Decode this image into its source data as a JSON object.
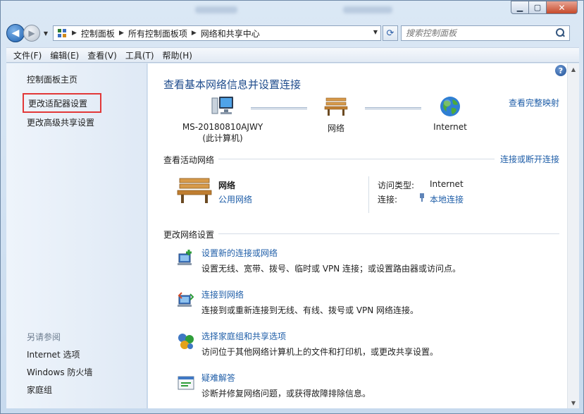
{
  "nav": {
    "breadcrumb": [
      "控制面板",
      "所有控制面板项",
      "网络和共享中心"
    ],
    "search_placeholder": "搜索控制面板"
  },
  "menu": [
    "文件(F)",
    "编辑(E)",
    "查看(V)",
    "工具(T)",
    "帮助(H)"
  ],
  "left_pane": {
    "links": [
      "控制面板主页",
      "更改适配器设置",
      "更改高级共享设置"
    ],
    "selected_link": "更改适配器设置",
    "see_also_header": "另请参阅",
    "see_also": [
      "Internet 选项",
      "Windows 防火墙",
      "家庭组"
    ]
  },
  "main": {
    "title": "查看基本网络信息并设置连接",
    "full_map_link": "查看完整映射",
    "nodes": [
      {
        "label": "MS-20180810AJWY",
        "sub": "(此计算机)",
        "icon": "computer-icon"
      },
      {
        "label": "网络",
        "sub": "",
        "icon": "bench-network-icon"
      },
      {
        "label": "Internet",
        "sub": "",
        "icon": "globe-icon"
      }
    ],
    "active_networks_label": "查看活动网络",
    "connect_disconnect_link": "连接或断开连接",
    "active_network": {
      "name": "网络",
      "type": "公用网络",
      "access_type_label": "访问类型:",
      "access_type_value": "Internet",
      "connection_label": "连接:",
      "connection_value": "本地连接"
    },
    "change_settings_label": "更改网络设置",
    "tasks": [
      {
        "title": "设置新的连接或网络",
        "desc": "设置无线、宽带、拨号、临时或 VPN 连接；或设置路由器或访问点。",
        "icon": "new-connection-icon"
      },
      {
        "title": "连接到网络",
        "desc": "连接到或重新连接到无线、有线、拨号或 VPN 网络连接。",
        "icon": "connect-network-icon"
      },
      {
        "title": "选择家庭组和共享选项",
        "desc": "访问位于其他网络计算机上的文件和打印机，或更改共享设置。",
        "icon": "homegroup-icon"
      },
      {
        "title": "疑难解答",
        "desc": "诊断并修复网络问题，或获得故障排除信息。",
        "icon": "troubleshoot-icon"
      }
    ]
  },
  "colors": {
    "link": "#1f5ea8",
    "title": "#1e4b8c",
    "selection_box": "#e23838"
  }
}
